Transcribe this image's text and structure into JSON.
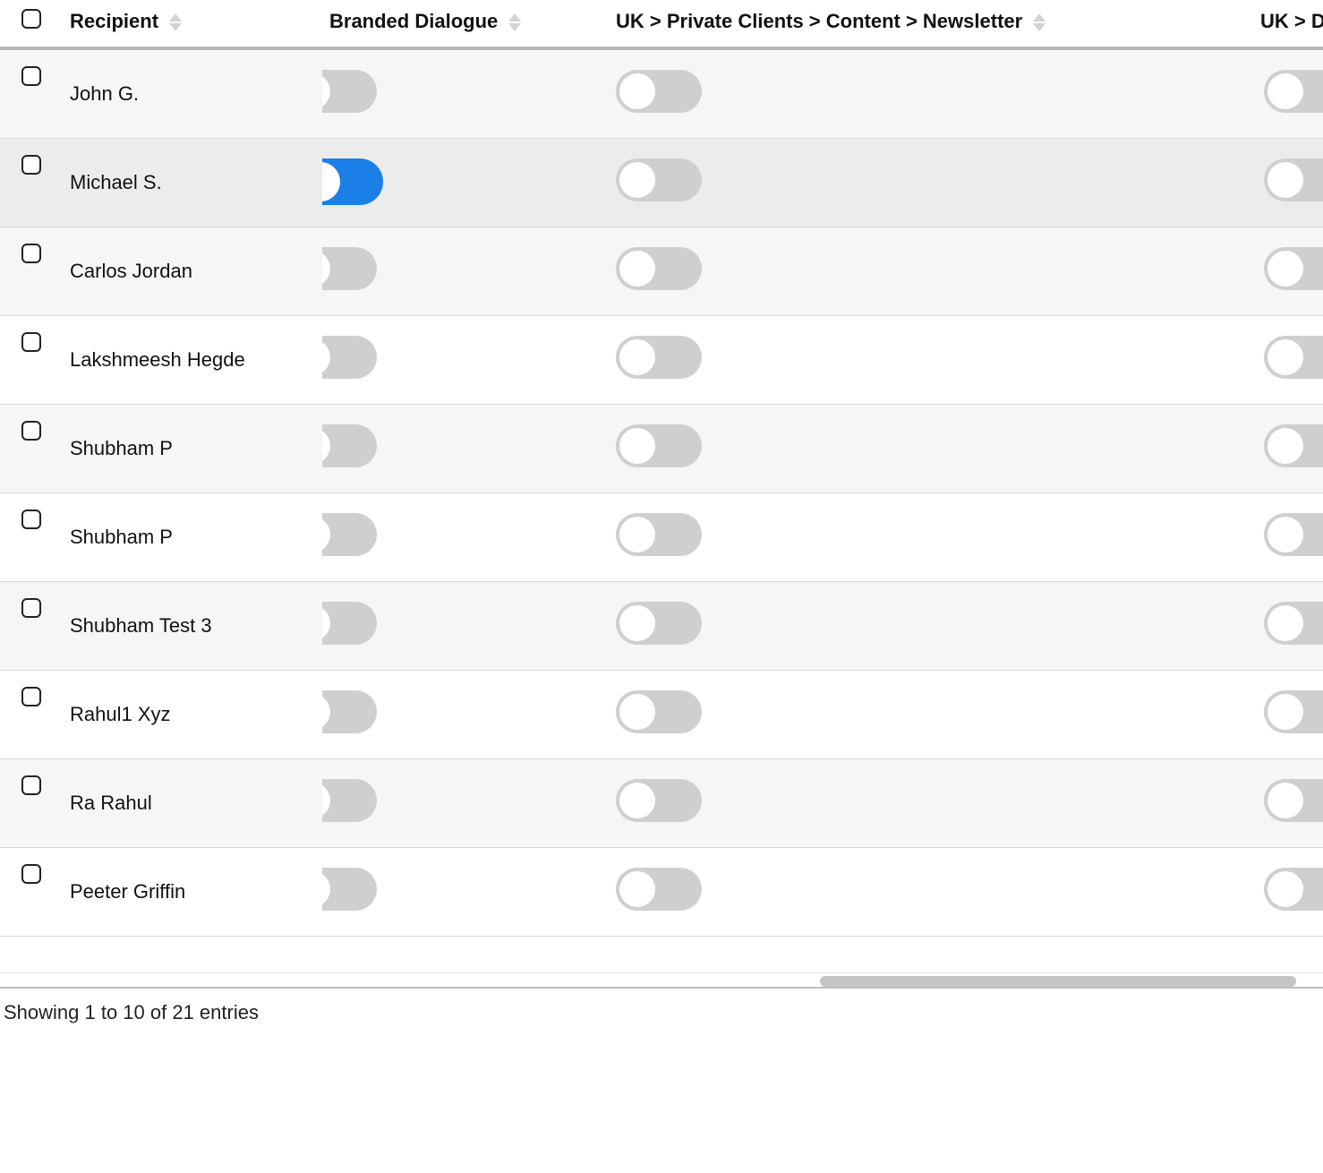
{
  "columns": {
    "recipient": "Recipient",
    "branded": "Branded Dialogue",
    "newsletter": "UK > Private Clients > Content > Newsletter",
    "dfm": "UK > DFM"
  },
  "rows": [
    {
      "name": "John G.",
      "branded_selected": false,
      "newsletter_on": false,
      "dfm_on": false,
      "checked": false
    },
    {
      "name": "Michael S.",
      "branded_selected": true,
      "newsletter_on": false,
      "dfm_on": false,
      "checked": false,
      "hovered": true
    },
    {
      "name": "Carlos Jordan",
      "branded_selected": false,
      "newsletter_on": false,
      "dfm_on": false,
      "checked": false
    },
    {
      "name": "Lakshmeesh Hegde",
      "branded_selected": false,
      "newsletter_on": false,
      "dfm_on": false,
      "checked": false
    },
    {
      "name": "Shubham P",
      "branded_selected": false,
      "newsletter_on": false,
      "dfm_on": false,
      "checked": false
    },
    {
      "name": "Shubham P",
      "branded_selected": false,
      "newsletter_on": false,
      "dfm_on": false,
      "checked": false
    },
    {
      "name": "Shubham Test 3",
      "branded_selected": false,
      "newsletter_on": false,
      "dfm_on": false,
      "checked": false
    },
    {
      "name": "Rahul1 Xyz",
      "branded_selected": false,
      "newsletter_on": false,
      "dfm_on": false,
      "checked": false
    },
    {
      "name": "Ra Rahul",
      "branded_selected": false,
      "newsletter_on": false,
      "dfm_on": false,
      "checked": false
    },
    {
      "name": "Peeter Griffin",
      "branded_selected": false,
      "newsletter_on": false,
      "dfm_on": false,
      "checked": false
    }
  ],
  "footer": "Showing 1 to 10 of 21 entries",
  "scroll": {
    "thumb_left_pct": 62,
    "thumb_width_pct": 36
  }
}
